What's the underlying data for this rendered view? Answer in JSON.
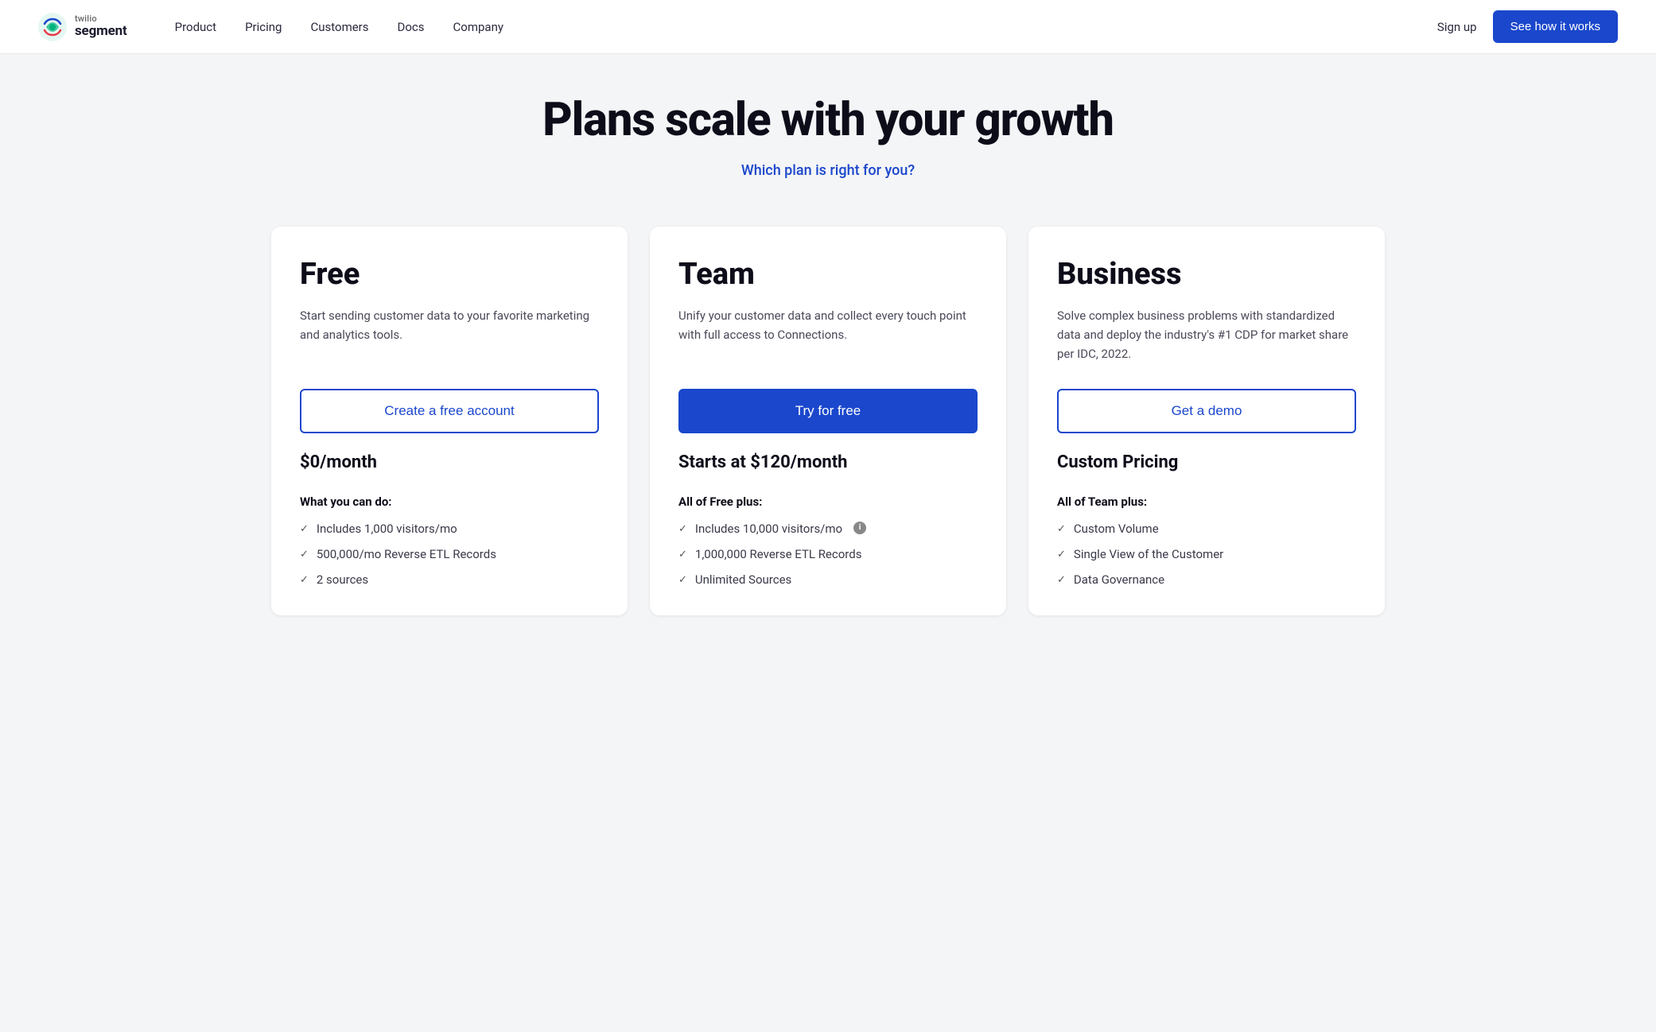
{
  "nav": {
    "logo_twilio": "twilio",
    "logo_segment": "segment",
    "links": [
      {
        "label": "Product",
        "id": "product"
      },
      {
        "label": "Pricing",
        "id": "pricing"
      },
      {
        "label": "Customers",
        "id": "customers"
      },
      {
        "label": "Docs",
        "id": "docs"
      },
      {
        "label": "Company",
        "id": "company"
      }
    ],
    "signup_label": "Sign up",
    "cta_label": "See how it works"
  },
  "hero": {
    "title": "Plans scale with your growth",
    "subtitle": "Which plan is right for you?"
  },
  "plans": [
    {
      "id": "free",
      "name": "Free",
      "description": "Start sending customer data to your favorite marketing and analytics tools.",
      "cta_label": "Create a free account",
      "cta_type": "outline",
      "price": "$0/month",
      "features_label": "What you can do:",
      "features": [
        {
          "text": "Includes 1,000 visitors/mo",
          "info": false
        },
        {
          "text": "500,000/mo Reverse ETL Records",
          "info": false
        },
        {
          "text": "2 sources",
          "info": false
        }
      ]
    },
    {
      "id": "team",
      "name": "Team",
      "description": "Unify your customer data and collect every touch point with full access to Connections.",
      "cta_label": "Try for free",
      "cta_type": "primary",
      "price": "Starts at $120/month",
      "features_label": "All of Free plus:",
      "features": [
        {
          "text": "Includes 10,000 visitors/mo",
          "info": true
        },
        {
          "text": "1,000,000 Reverse ETL Records",
          "info": false
        },
        {
          "text": "Unlimited Sources",
          "info": false
        }
      ]
    },
    {
      "id": "business",
      "name": "Business",
      "description": "Solve complex business problems with standardized data and deploy the industry's #1 CDP for market share per IDC, 2022.",
      "cta_label": "Get a demo",
      "cta_type": "outline",
      "price": "Custom Pricing",
      "features_label": "All of Team plus:",
      "features": [
        {
          "text": "Custom Volume",
          "info": false
        },
        {
          "text": "Single View of the Customer",
          "info": false
        },
        {
          "text": "Data Governance",
          "info": false
        }
      ]
    }
  ]
}
